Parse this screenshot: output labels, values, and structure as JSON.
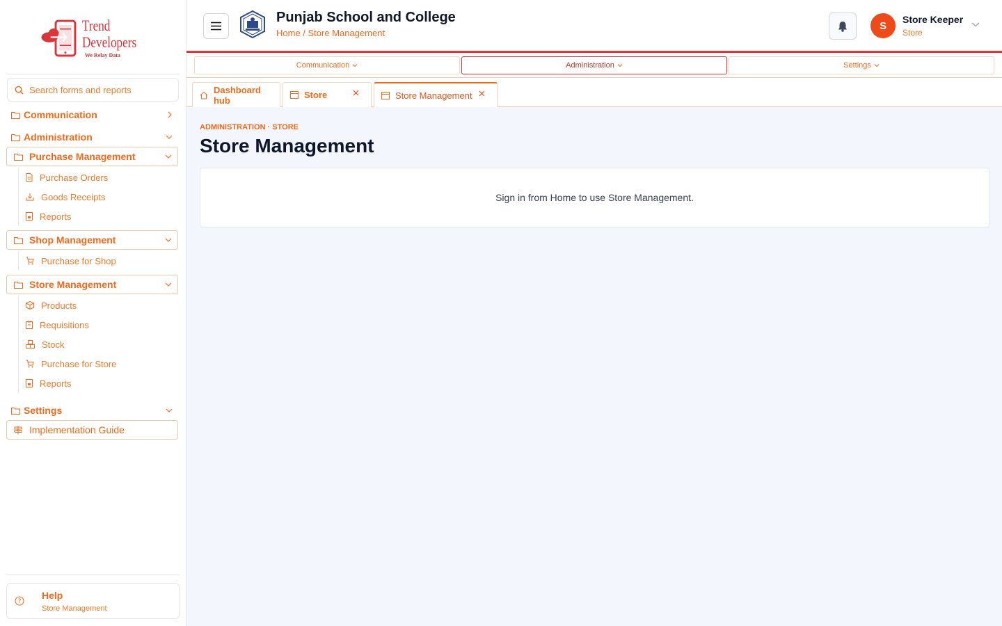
{
  "sidebar": {
    "logo": {
      "line1": "Trend",
      "line2": "Developers",
      "tagline": "We Relay Data"
    },
    "search": {
      "placeholder": "Search forms and reports"
    },
    "groups": {
      "communication": "Communication",
      "administration": "Administration",
      "settings": "Settings"
    },
    "purchase": {
      "label": "Purchase Management",
      "items": [
        "Purchase Orders",
        "Goods Receipts",
        "Reports"
      ]
    },
    "shop": {
      "label": "Shop Management",
      "items": [
        "Purchase for Shop"
      ]
    },
    "store": {
      "label": "Store Management",
      "items": [
        "Products",
        "Requisitions",
        "Stock",
        "Purchase for Store",
        "Reports"
      ]
    },
    "implementation": "Implementation Guide",
    "help": {
      "title": "Help",
      "subtitle": "Store Management"
    }
  },
  "header": {
    "school": "Punjab School and College",
    "breadcrumb": "Home / Store Management",
    "user": {
      "initial": "S",
      "name": "Store Keeper",
      "role": "Store"
    }
  },
  "topnav": [
    "Communication",
    "Administration",
    "Settings"
  ],
  "tabs": [
    "Dashboard hub",
    "Store",
    "Store Management"
  ],
  "main": {
    "eyebrow": "ADMINISTRATION · STORE",
    "title": "Store Management",
    "message": "Sign in from Home to use Store Management."
  },
  "colors": {
    "accent": "#ef6a1a",
    "brand_red": "#e0363a",
    "background": "#f3f6fd"
  }
}
